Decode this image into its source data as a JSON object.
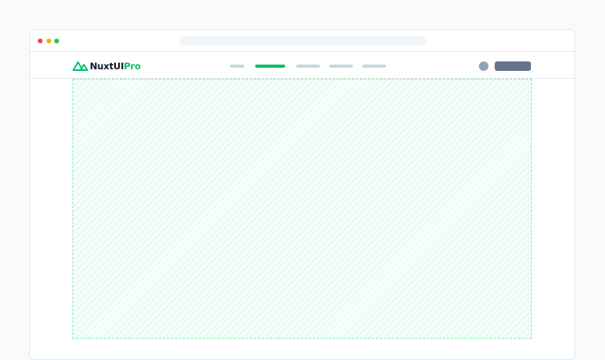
{
  "browser": {
    "traffic_lights": {
      "close_color": "#ef4444",
      "minimize_color": "#eab308",
      "maximize_color": "#22c55e"
    }
  },
  "navbar": {
    "logo": {
      "primary": "NuxtUI",
      "accent": "Pro",
      "icon": "nuxt-mountain-icon",
      "accent_color": "#00c16a"
    },
    "nav_items": [
      {
        "state": "inactive"
      },
      {
        "state": "active"
      },
      {
        "state": "inactive"
      },
      {
        "state": "inactive"
      },
      {
        "state": "inactive"
      }
    ],
    "user": {
      "icon": "avatar"
    }
  },
  "theme": {
    "brand": "#00c16a",
    "placeholder_border": "#86efac"
  }
}
